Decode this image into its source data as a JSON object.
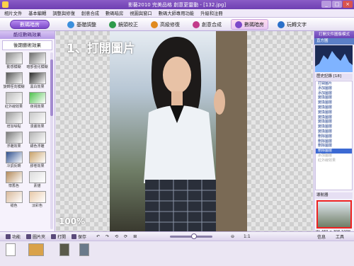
{
  "window": {
    "title": "影藝2010 完美品格 創意更靈動 - [132.jpg]"
  },
  "menu": [
    "相片文件",
    "基本編輯",
    "調整與修復",
    "創意合成",
    "數碼暗房",
    "視圖與窗口",
    "數碼大師專用功能",
    "升級和注冊"
  ],
  "toolbar": {
    "primary": "數碼暗房",
    "tabs": [
      {
        "label": "基礎調整",
        "icon": "adjust-icon",
        "color": "#3b8fdc"
      },
      {
        "label": "鏡頭校正",
        "icon": "lens-icon",
        "color": "#2d9a4a"
      },
      {
        "label": "高級修復",
        "icon": "repair-icon",
        "color": "#e08a1e"
      },
      {
        "label": "創意合成",
        "icon": "compose-icon",
        "color": "#c23b8a"
      },
      {
        "label": "數碼暗房",
        "icon": "darkroom-icon",
        "color": "#7c48c9"
      },
      {
        "label": "玩轉文字",
        "icon": "text-icon",
        "color": "#2a6fc9"
      }
    ],
    "active_tab": "數碼暗房"
  },
  "left_panel": {
    "header": "酷炫數碼效果",
    "subheader": "後期藝術效果",
    "effects": [
      {
        "label": "動感模糊",
        "color": "#8a8a8a"
      },
      {
        "label": "暗部強化模糊",
        "color": "#6d6d6d"
      },
      {
        "label": "旋轉徑向模糊",
        "color": "#555555"
      },
      {
        "label": "黑白效果",
        "color": "#2a2a2a"
      },
      {
        "label": "紅外線效果",
        "color": "#b9b9b9"
      },
      {
        "label": "夜視效果",
        "color": "#4ec24e"
      },
      {
        "label": "增加噪點",
        "color": "#9a9a9a"
      },
      {
        "label": "漫畫效果",
        "color": "#c8c8c8"
      },
      {
        "label": "浮雕效果",
        "color": "#7a7a7a"
      },
      {
        "label": "銀色浮雕",
        "color": "#b3b3b3"
      },
      {
        "label": "冷調反轉",
        "color": "#2f4f8f"
      },
      {
        "label": "膠卷效果",
        "color": "#c9a26a"
      },
      {
        "label": "懷舊色",
        "color": "#b58a5a"
      },
      {
        "label": "素描",
        "color": "#dcdcdc"
      },
      {
        "label": "褪色",
        "color": "#d9b99a"
      },
      {
        "label": "淡彩色",
        "color": "#e8c9a8"
      }
    ]
  },
  "canvas": {
    "overlay_title": "1、打開圖片",
    "zoom": "100%"
  },
  "right_panel": {
    "header": "打開文件圖像模式",
    "subheader": "直方圖",
    "history_header": "歷史記錄 [18]",
    "history": [
      "打開圖片",
      "添加圖層",
      "添加圖層",
      "變換圖層",
      "變換圖層",
      "變換圖層",
      "變換圖層",
      "變換圖層",
      "變換圖層",
      "變換圖層",
      "變換圖層",
      "刪除圖層",
      "刪除圖層",
      "刪除圖層",
      "刪除圖層",
      "添加圖層",
      "紅外線效果"
    ],
    "history_selected_index": 14,
    "history_dimmed_from": 15,
    "navigator_header": "導航器",
    "navigator_info": "W: 460 × 306  100%"
  },
  "bottom_bar": {
    "labels": [
      "功能",
      "圖片夾",
      "打開",
      "保存",
      "1:1"
    ],
    "zoom_slider_value": 0.5,
    "right_labels": [
      "信息",
      "工具"
    ]
  }
}
